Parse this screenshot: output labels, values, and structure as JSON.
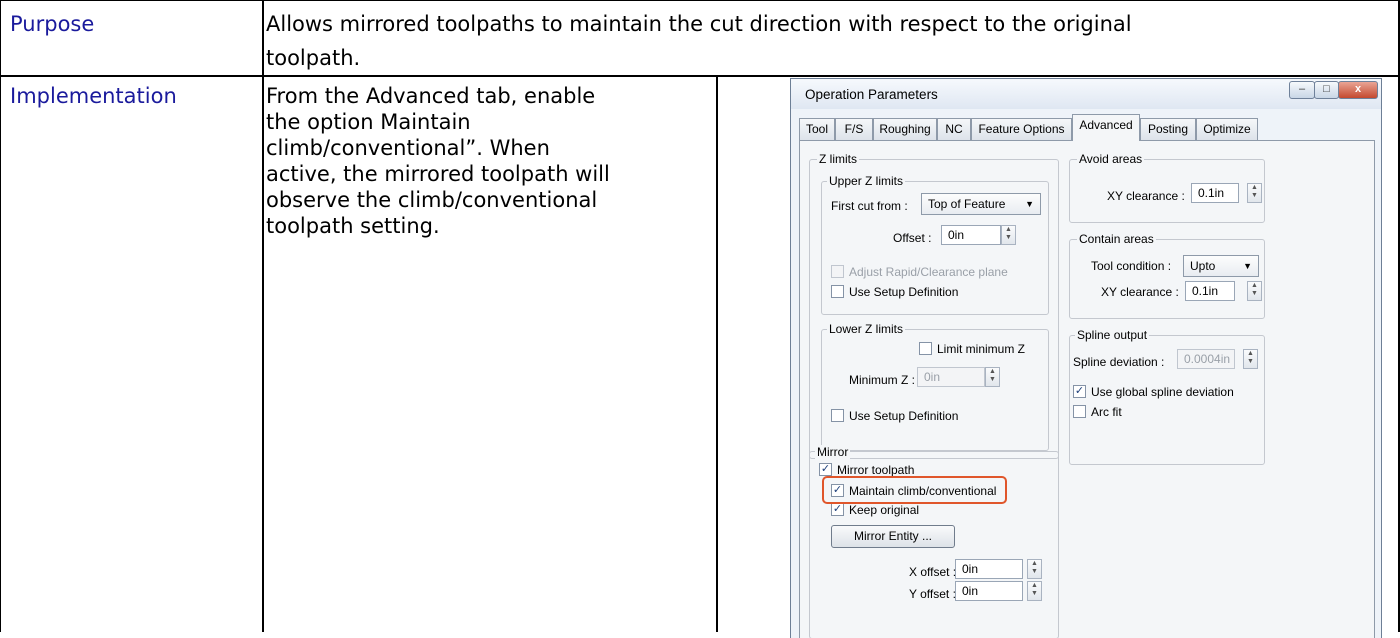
{
  "table": {
    "purpose_label": "Purpose",
    "purpose_line1": "Allows mirrored toolpaths to maintain the cut direction with respect to the original",
    "purpose_line2": "toolpath.",
    "impl_label": "Implementation",
    "impl_lines": [
      "From the Advanced tab, enable",
      "the option Maintain",
      "climb/conventional”.  When",
      "active, the mirrored toolpath will",
      "observe the climb/conventional",
      "toolpath setting."
    ]
  },
  "dialog": {
    "title": "Operation Parameters",
    "window_buttons": [
      "–",
      "□",
      "x"
    ],
    "tabs": [
      "Tool",
      "F/S",
      "Roughing",
      "NC",
      "Feature Options",
      "Advanced",
      "Posting",
      "Optimize"
    ],
    "active_tab": "Advanced",
    "z_limits": {
      "title": "Z limits",
      "upper_title": "Upper Z limits",
      "first_cut_label": "First cut from :",
      "first_cut_value": "Top of Feature",
      "offset_label": "Offset :",
      "offset_value": "0in",
      "adjust_rapid_label": "Adjust Rapid/Clearance plane",
      "use_setup_label": "Use Setup Definition",
      "lower_title": "Lower Z limits",
      "limit_min_label": "Limit minimum Z",
      "min_z_label": "Minimum Z :",
      "min_z_value": "0in",
      "use_setup_label_2": "Use Setup Definition"
    },
    "avoid_areas": {
      "title": "Avoid areas",
      "xy_label": "XY clearance :",
      "xy_value": "0.1in"
    },
    "contain_areas": {
      "title": "Contain areas",
      "tool_condition_label": "Tool condition :",
      "tool_condition_value": "Upto",
      "xy_label": "XY clearance :",
      "xy_value": "0.1in"
    },
    "spline": {
      "title": "Spline output",
      "deviation_label": "Spline deviation :",
      "deviation_value": "0.0004in",
      "use_global_label": "Use global spline deviation",
      "use_global_checked": true,
      "arc_fit_label": "Arc fit",
      "arc_fit_checked": false
    },
    "mirror": {
      "title": "Mirror",
      "mirror_toolpath_label": "Mirror toolpath",
      "maintain_label": "Maintain climb/conventional",
      "keep_original_label": "Keep original",
      "mirror_entity_button": "Mirror Entity ...",
      "x_offset_label": "X offset :",
      "x_offset_value": "0in",
      "y_offset_label": "Y offset :",
      "y_offset_value": "0in"
    },
    "check_mark": "✓",
    "spin_up": "▲",
    "spin_down": "▼",
    "combo_arrow": "▼"
  }
}
